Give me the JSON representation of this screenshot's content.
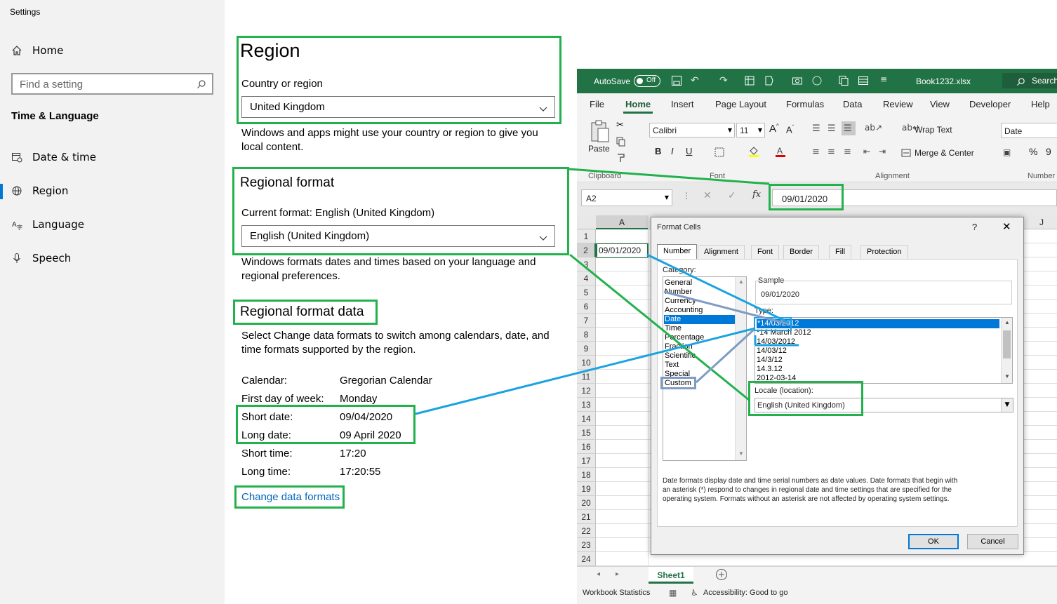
{
  "settings": {
    "window_title": "Settings",
    "nav_home": "Home",
    "search_placeholder": "Find a setting",
    "category": "Time & Language",
    "nav_items": [
      "Date & time",
      "Region",
      "Language",
      "Speech"
    ],
    "region": {
      "title": "Region",
      "country_label": "Country or region",
      "country_value": "United Kingdom",
      "country_desc_1": "Windows and apps might use your country or region to give you",
      "country_desc_2": "local content."
    },
    "regional_format": {
      "title": "Regional format",
      "current_label": "Current format: English (United Kingdom)",
      "value": "English (United Kingdom)",
      "desc_1": "Windows formats dates and times based on your language and",
      "desc_2": "regional preferences."
    },
    "format_data": {
      "title": "Regional format data",
      "desc_1": "Select Change data formats to switch among calendars, date, and",
      "desc_2": "time formats supported by the region.",
      "rows": [
        {
          "label": "Calendar:",
          "value": "Gregorian Calendar"
        },
        {
          "label": "First day of week:",
          "value": "Monday"
        },
        {
          "label": "Short date:",
          "value": "09/04/2020"
        },
        {
          "label": "Long date:",
          "value": "09 April 2020"
        },
        {
          "label": "Short time:",
          "value": "17:20"
        },
        {
          "label": "Long time:",
          "value": "17:20:55"
        }
      ],
      "change_link": "Change data formats"
    }
  },
  "excel": {
    "autosave": "AutoSave",
    "autosave_state": "Off",
    "filename": "Book1232.xlsx",
    "search": "Search",
    "menu": [
      "File",
      "Home",
      "Insert",
      "Page Layout",
      "Formulas",
      "Data",
      "Review",
      "View",
      "Developer",
      "Help"
    ],
    "font_name": "Calibri",
    "font_size": "11",
    "paste": "Paste",
    "wrap_text": "Wrap Text",
    "merge_center": "Merge & Center",
    "number_format": "Date",
    "groups": [
      "Clipboard",
      "Font",
      "Alignment",
      "Number"
    ],
    "name_box": "A2",
    "formula_value": "09/01/2020",
    "col_a": "A",
    "col_j": "J",
    "cell_a2": "09/01/2020",
    "rows": [
      "1",
      "2",
      "3",
      "4",
      "5",
      "6",
      "7",
      "8",
      "9",
      "10",
      "11",
      "12",
      "13",
      "14",
      "15",
      "16",
      "17",
      "18",
      "19",
      "20",
      "21",
      "22",
      "23",
      "24"
    ],
    "sheet_tab": "Sheet1",
    "status_stats": "Workbook Statistics",
    "status_access": "Accessibility: Good to go"
  },
  "dialog": {
    "title": "Format Cells",
    "help": "?",
    "tabs": [
      "Number",
      "Alignment",
      "Font",
      "Border",
      "Fill",
      "Protection"
    ],
    "category_label": "Category:",
    "categories": [
      "General",
      "Number",
      "Currency",
      "Accounting",
      "Date",
      "Time",
      "Percentage",
      "Fraction",
      "Scientific",
      "Text",
      "Special",
      "Custom"
    ],
    "sample_label": "Sample",
    "sample_value": "09/01/2020",
    "type_label": "Type:",
    "types": [
      "*14/03/2012",
      "*14 March 2012",
      "14/03/2012",
      "14/03/12",
      "14/3/12",
      "14.3.12",
      "2012-03-14"
    ],
    "locale_label": "Locale (location):",
    "locale_value": "English (United Kingdom)",
    "description": [
      "Date formats display date and time serial numbers as date values.  Date formats that begin with",
      "an asterisk (*) respond to changes in regional date and time settings that are specified for the",
      "operating system. Formats without an asterisk are not affected by operating system settings."
    ],
    "ok": "OK",
    "cancel": "Cancel"
  },
  "colors": {
    "green_highlight": "#22b14c",
    "blue_arrow": "#1aa3e0",
    "steel_arrow": "#7f9cc4",
    "excel_green": "#217346",
    "selection_blue": "#0078d7"
  }
}
